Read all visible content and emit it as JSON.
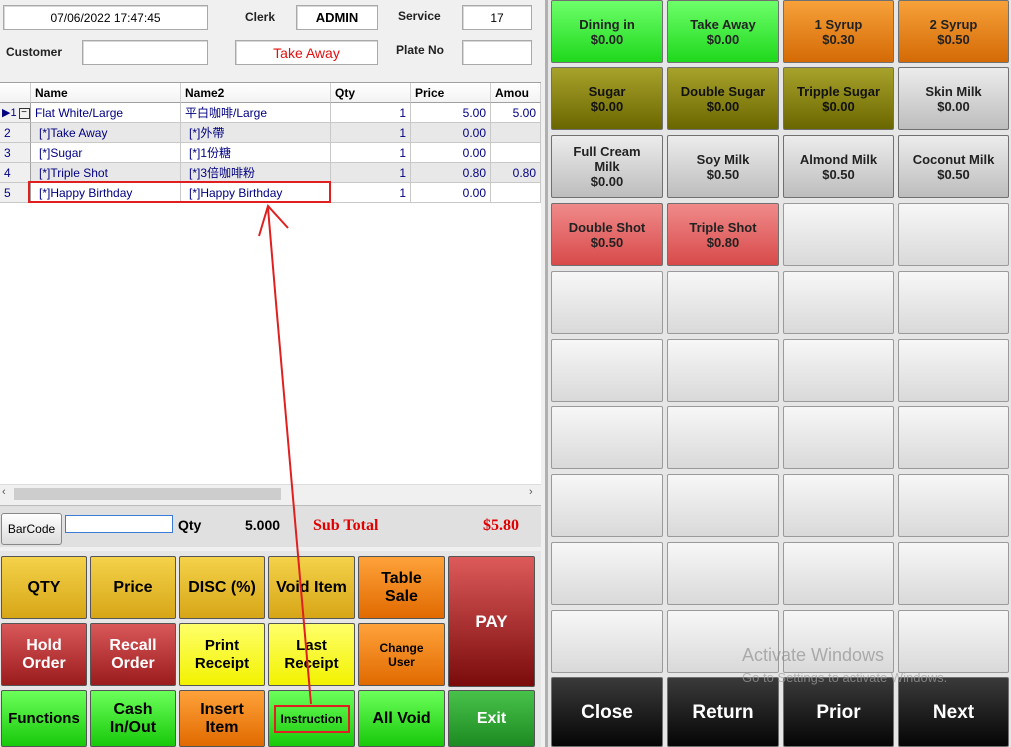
{
  "header": {
    "datetime": "07/06/2022 17:47:45",
    "clerk_label": "Clerk",
    "clerk_value": "ADMIN",
    "service_label": "Service",
    "service_value": "17",
    "customer_label": "Customer",
    "customer_value": "",
    "order_type": "Take Away",
    "plate_label": "Plate No",
    "plate_value": ""
  },
  "grid": {
    "columns": [
      "Name",
      "Name2",
      "Qty",
      "Price",
      "Amou"
    ],
    "rows": [
      {
        "idx": "1",
        "name": "Flat White/Large",
        "name2": "平白咖啡/Large",
        "qty": "1",
        "price": "5.00",
        "amount": "5.00"
      },
      {
        "idx": "2",
        "name": "[*]Take Away",
        "name2": "[*]外帶",
        "qty": "1",
        "price": "0.00",
        "amount": ""
      },
      {
        "idx": "3",
        "name": "[*]Sugar",
        "name2": "[*]1份糖",
        "qty": "1",
        "price": "0.00",
        "amount": ""
      },
      {
        "idx": "4",
        "name": "[*]Triple Shot",
        "name2": "[*]3倍咖啡粉",
        "qty": "1",
        "price": "0.80",
        "amount": "0.80"
      },
      {
        "idx": "5",
        "name": "[*]Happy Birthday",
        "name2": "[*]Happy Birthday",
        "qty": "1",
        "price": "0.00",
        "amount": ""
      }
    ]
  },
  "summary": {
    "barcode_label": "BarCode",
    "barcode_value": "",
    "qty_label": "Qty",
    "qty_value": "5.000",
    "subtotal_label": "Sub Total",
    "subtotal_value": "$5.80"
  },
  "functions": {
    "qty": "QTY",
    "price": "Price",
    "disc": "DISC (%)",
    "void_item": "Void Item",
    "table_sale_1": "Table",
    "table_sale_2": "Sale",
    "pay": "PAY",
    "hold_1": "Hold",
    "hold_2": "Order",
    "recall_1": "Recall",
    "recall_2": "Order",
    "print_1": "Print",
    "print_2": "Receipt",
    "last_1": "Last",
    "last_2": "Receipt",
    "change_1": "Change",
    "change_2": "User",
    "functions": "Functions",
    "cash_1": "Cash",
    "cash_2": "In/Out",
    "insert_1": "Insert",
    "insert_2": "Item",
    "instruction": "Instruction",
    "all_void": "All Void",
    "exit": "Exit"
  },
  "modifiers": [
    {
      "name": "Dining in",
      "price": "$0.00"
    },
    {
      "name": "Take Away",
      "price": "$0.00"
    },
    {
      "name": "1 Syrup",
      "price": "$0.30"
    },
    {
      "name": "2 Syrup",
      "price": "$0.50"
    },
    {
      "name": "Sugar",
      "price": "$0.00"
    },
    {
      "name": "Double Sugar",
      "price": "$0.00"
    },
    {
      "name": "Tripple Sugar",
      "price": "$0.00"
    },
    {
      "name": "Skin Milk",
      "price": "$0.00"
    },
    {
      "name": "Full Cream Milk",
      "price": "$0.00"
    },
    {
      "name": "Soy Milk",
      "price": "$0.50"
    },
    {
      "name": "Almond Milk",
      "price": "$0.50"
    },
    {
      "name": "Coconut Milk",
      "price": "$0.50"
    },
    {
      "name": "Double Shot",
      "price": "$0.50"
    },
    {
      "name": "Triple Shot",
      "price": "$0.80"
    }
  ],
  "nav": {
    "close": "Close",
    "return": "Return",
    "prior": "Prior",
    "next": "Next"
  },
  "watermark": {
    "line1": "Activate Windows",
    "line2": "Go to Settings to activate Windows."
  },
  "colors": {
    "annotation_red": "#e02020",
    "subtotal_red": "#e00000"
  }
}
